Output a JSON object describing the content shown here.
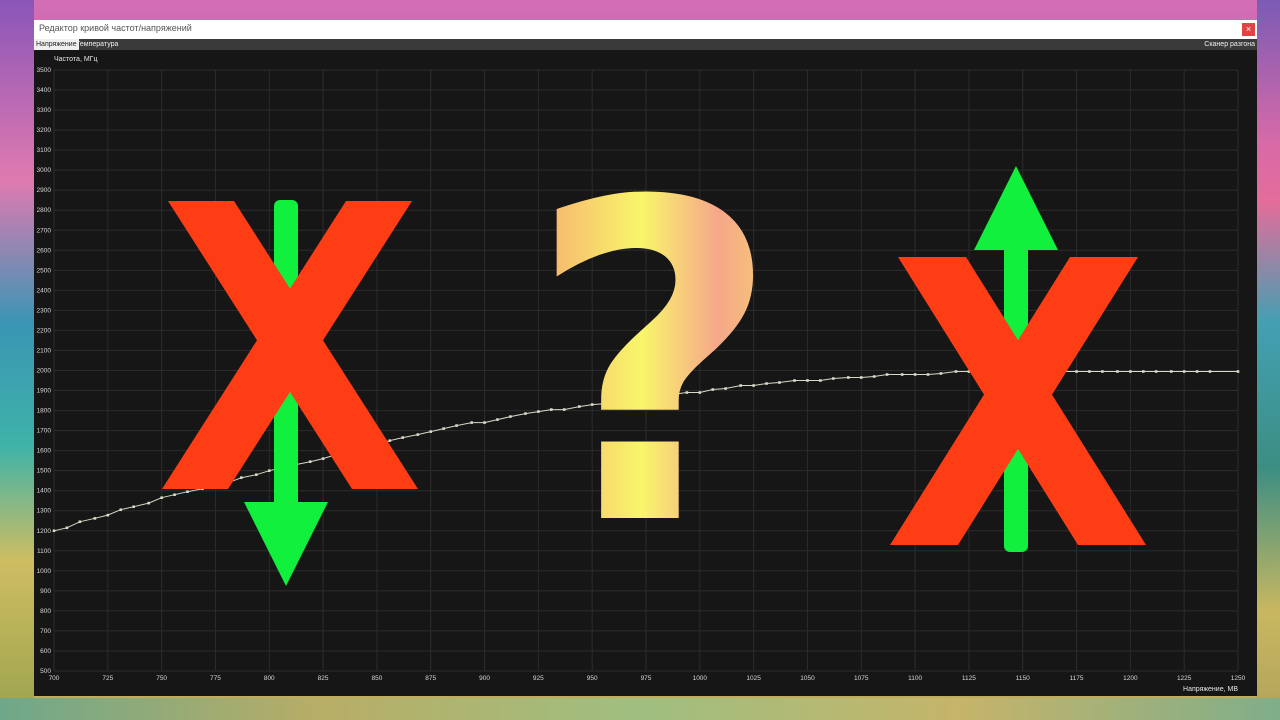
{
  "window": {
    "title": "Редактор кривой частот/напряжений",
    "close_glyph": "×"
  },
  "tabs": [
    {
      "label": "Напряжение",
      "active": true
    },
    {
      "label": "Температура",
      "active": false
    }
  ],
  "scanner_label": "Сканер разгона",
  "chart_data": {
    "type": "line",
    "ylabel": "Частота, МГц",
    "xlabel": "Напряжение, МВ",
    "xlim": [
      700,
      1250
    ],
    "ylim": [
      500,
      3500
    ],
    "xticks": [
      700,
      725,
      750,
      775,
      800,
      825,
      850,
      875,
      900,
      925,
      950,
      975,
      1000,
      1025,
      1050,
      1075,
      1100,
      1125,
      1150,
      1175,
      1200,
      1225,
      1250
    ],
    "yticks": [
      500,
      600,
      700,
      800,
      900,
      1000,
      1100,
      1200,
      1300,
      1400,
      1500,
      1600,
      1700,
      1800,
      1900,
      2000,
      2100,
      2200,
      2300,
      2400,
      2500,
      2600,
      2700,
      2800,
      2900,
      3000,
      3100,
      3200,
      3300,
      3400,
      3500
    ],
    "grid": true,
    "series": [
      {
        "color": "#d9d9c8",
        "x": [
          700,
          706,
          712,
          719,
          725,
          731,
          737,
          744,
          750,
          756,
          762,
          769,
          775,
          781,
          787,
          794,
          800,
          806,
          812,
          819,
          825,
          831,
          837,
          844,
          850,
          856,
          862,
          869,
          875,
          881,
          887,
          894,
          900,
          906,
          912,
          919,
          925,
          931,
          937,
          944,
          950,
          956,
          962,
          969,
          975,
          981,
          987,
          994,
          1000,
          1006,
          1012,
          1019,
          1025,
          1031,
          1037,
          1044,
          1050,
          1056,
          1062,
          1069,
          1075,
          1081,
          1087,
          1094,
          1100,
          1106,
          1112,
          1119,
          1125,
          1131,
          1137,
          1144,
          1150,
          1156,
          1162,
          1169,
          1175,
          1181,
          1187,
          1194,
          1200,
          1206,
          1212,
          1219,
          1225,
          1231,
          1237,
          1250
        ],
        "y": [
          1200,
          1215,
          1245,
          1262,
          1278,
          1305,
          1320,
          1338,
          1365,
          1380,
          1395,
          1410,
          1425,
          1440,
          1465,
          1480,
          1500,
          1515,
          1530,
          1545,
          1560,
          1580,
          1600,
          1615,
          1630,
          1650,
          1665,
          1680,
          1695,
          1710,
          1725,
          1740,
          1740,
          1755,
          1770,
          1785,
          1795,
          1805,
          1805,
          1820,
          1830,
          1835,
          1840,
          1855,
          1860,
          1870,
          1880,
          1890,
          1890,
          1905,
          1910,
          1925,
          1925,
          1935,
          1940,
          1950,
          1950,
          1950,
          1960,
          1965,
          1965,
          1970,
          1980,
          1980,
          1980,
          1980,
          1985,
          1995,
          1995,
          1995,
          1995,
          1995,
          1995,
          1995,
          1995,
          1995,
          1995,
          1995,
          1995,
          1995,
          1995,
          1995,
          1995,
          1995,
          1995,
          1995,
          1995,
          1995
        ]
      }
    ]
  },
  "overlays": {
    "cross_color": "#ff3d14",
    "arrow_color": "#10f03c",
    "question_glyph": "?",
    "question_gradient": [
      "#f6a870",
      "#f8f66a",
      "#f6a78a",
      "#f5d070"
    ]
  }
}
